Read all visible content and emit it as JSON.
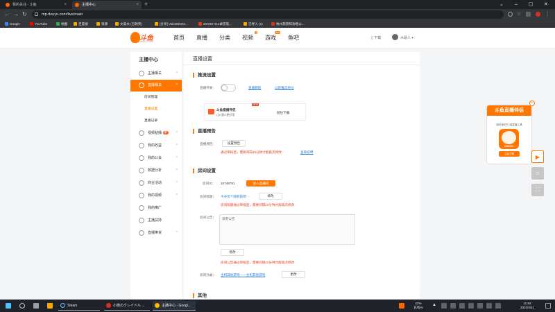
{
  "browser": {
    "tabs": [
      {
        "title": "我的关注 - 斗鱼",
        "active": false
      },
      {
        "title": "主播中心",
        "active": true
      }
    ],
    "url": "mp.douyu.com/live/main",
    "bookmarks": [
      "Google",
      "YouTube",
      "地图",
      "百度搜",
      "资源",
      "文案文 (已领奖)",
      "[分享] VoiceMeete...",
      "ZOOM H1n录音笔...",
      "已导入 (1)",
      "杭州旅游和攻略公..."
    ]
  },
  "header": {
    "logo_text": "斗鱼",
    "logo_sub": "DOUYU.COM",
    "nav": [
      "首页",
      "直播",
      "分类",
      "视频",
      "游戏",
      "鱼吧"
    ],
    "nav_badges": {
      "video": "●",
      "game": "HOT"
    },
    "download": "下载",
    "username": "木易人"
  },
  "sidebar": {
    "title": "主播中心",
    "items": [
      {
        "label": "主播相关",
        "arrow": "^"
      },
      {
        "label": "直播相关",
        "arrow": "^",
        "active": true
      },
      {
        "label": "视频粘播",
        "arrow": "^",
        "tag": "新"
      },
      {
        "label": "我的收益",
        "arrow": "^"
      },
      {
        "label": "我的公会",
        "arrow": "^"
      },
      {
        "label": "数据分析",
        "arrow": "^"
      },
      {
        "label": "商业活动",
        "arrow": "^"
      },
      {
        "label": "我的视频",
        "arrow": "^"
      },
      {
        "label": "我的推广"
      },
      {
        "label": "主播扶持"
      },
      {
        "label": "直播带货",
        "arrow": "^"
      }
    ],
    "sub_items": [
      "房间管理",
      "直播设置",
      "直播记录"
    ]
  },
  "main": {
    "title": "直播设置",
    "section_stream": "推流设置",
    "stream_switch_label": "直播开关：",
    "stream_tutorial": "直播教程",
    "stream_addr": "以前推流地址",
    "promo_title": "斗鱼直播伴侣",
    "promo_sub": "让O到O更好用",
    "promo_new": "NEW",
    "promo_btn": "前往下载",
    "section_notice": "直播预告",
    "notice_label": "直播预告：",
    "notice_btn": "设置预告",
    "notice_warn": "通过审核后，需要间隔10分钟才能再次修改",
    "notice_link": "查看说明",
    "section_room": "房间设置",
    "room_id_label": "房间ID：",
    "room_id": "10748781",
    "room_enter": "进入直播间",
    "room_title_label": "房间标题：",
    "room_title": "今天玩个随机搞吧",
    "room_title_btn": "修改",
    "room_title_warn": "房间标题通过审核后，需要间隔10分钟才能再次修改",
    "room_notice_label": "房间公告：",
    "room_notice_placeholder": "没有公告",
    "room_notice_btn": "修改",
    "room_notice_warn": "房间公告通过审核后，需要间隔10分钟才能再次修改",
    "room_category_label": "房间分类：",
    "room_category": "主机其他游戏——主机其他游戏",
    "room_category_btn": "更改",
    "section_other": "其他"
  },
  "ad": {
    "banner": "斗鱼直播伴侣",
    "desc": "超好用的PC端直播工具",
    "brand": "DOUYU",
    "download": "立即下载",
    "close": "×"
  },
  "taskbar": {
    "apps": [
      "Steam",
      "小熊のクレイドル ...",
      "主播中心 - Googl..."
    ],
    "weather_temp": "22%",
    "weather_desc": "已有AI",
    "time": "11:53",
    "date": "2022/4/11"
  },
  "colors": {
    "accent": "#ff7700",
    "warn": "#e8391a",
    "link": "#2b7cd3"
  }
}
